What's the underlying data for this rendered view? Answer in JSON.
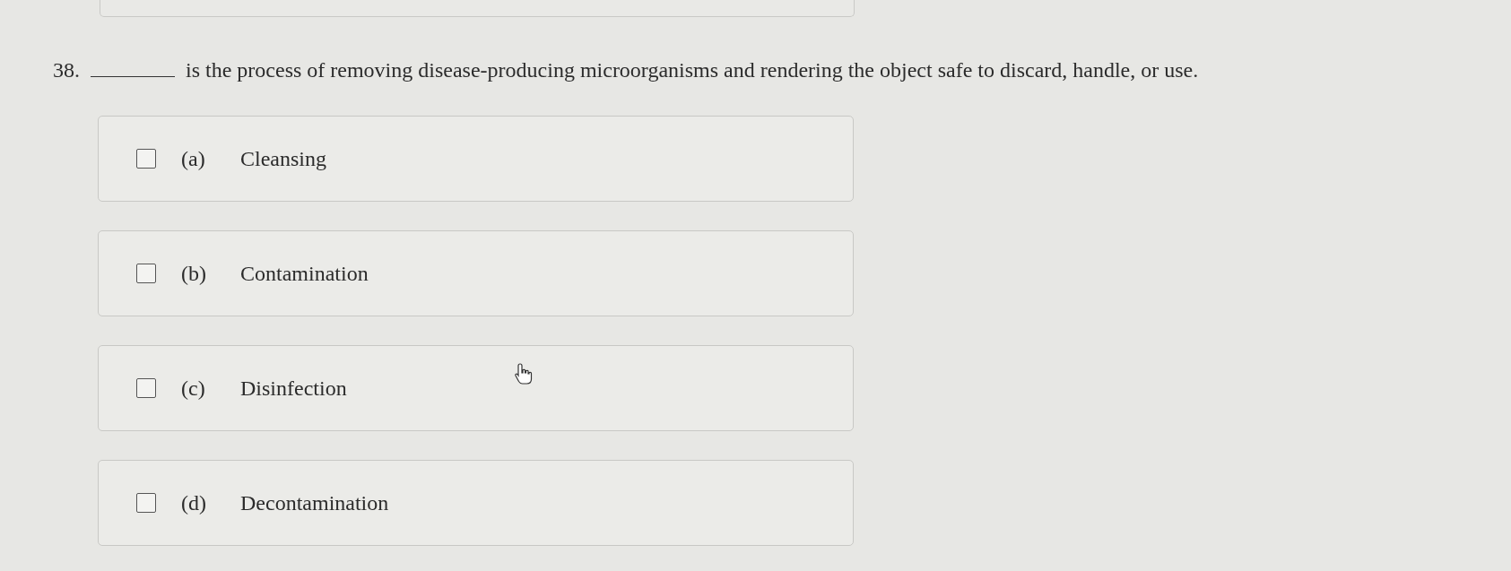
{
  "question": {
    "number": "38.",
    "text": "is the process of removing disease-producing microorganisms and rendering the object safe to discard, handle, or use."
  },
  "options": [
    {
      "letter": "(a)",
      "text": "Cleansing",
      "checked": false
    },
    {
      "letter": "(b)",
      "text": "Contamination",
      "checked": false
    },
    {
      "letter": "(c)",
      "text": "Disinfection",
      "checked": false
    },
    {
      "letter": "(d)",
      "text": "Decontamination",
      "checked": false
    }
  ]
}
